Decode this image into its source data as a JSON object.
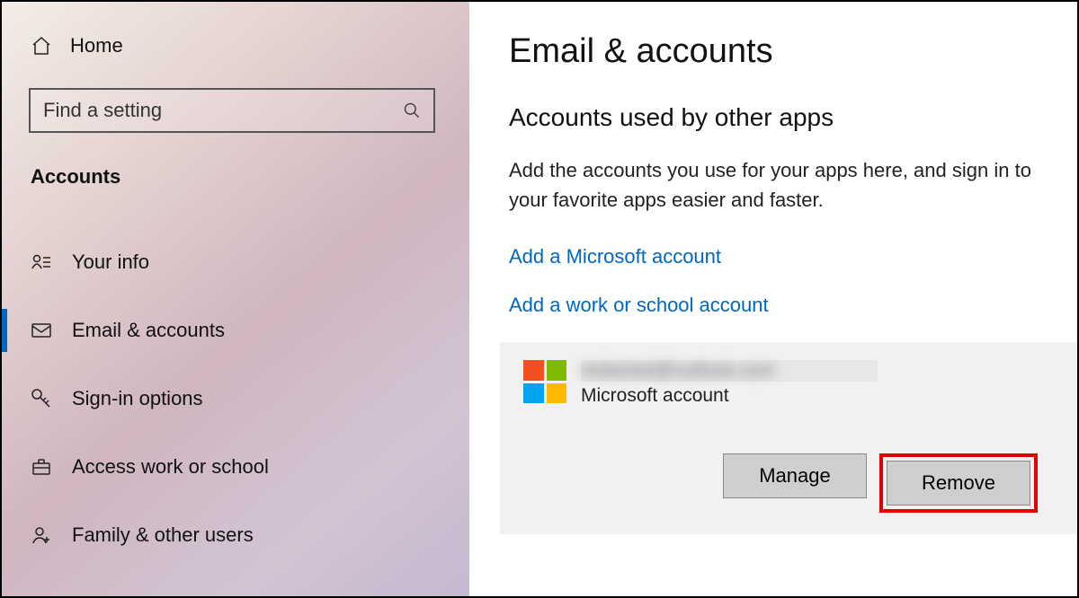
{
  "sidebar": {
    "home_label": "Home",
    "search_placeholder": "Find a setting",
    "section_label": "Accounts",
    "items": [
      {
        "id": "your-info",
        "label": "Your info",
        "selected": false
      },
      {
        "id": "email-accounts",
        "label": "Email & accounts",
        "selected": true
      },
      {
        "id": "sign-in-options",
        "label": "Sign-in options",
        "selected": false
      },
      {
        "id": "access-work-school",
        "label": "Access work or school",
        "selected": false
      },
      {
        "id": "family-other-users",
        "label": "Family & other users",
        "selected": false
      }
    ]
  },
  "main": {
    "title": "Email & accounts",
    "subtitle": "Accounts used by other apps",
    "description": "Add the accounts you use for your apps here, and sign in to your favorite apps easier and faster.",
    "links": {
      "add_ms": "Add a Microsoft account",
      "add_work": "Add a work or school account"
    },
    "account": {
      "email_redacted": "redacted@outlook.com",
      "type": "Microsoft account",
      "manage_label": "Manage",
      "remove_label": "Remove"
    }
  },
  "colors": {
    "accent": "#0067c0",
    "highlight_border": "#e20000"
  }
}
